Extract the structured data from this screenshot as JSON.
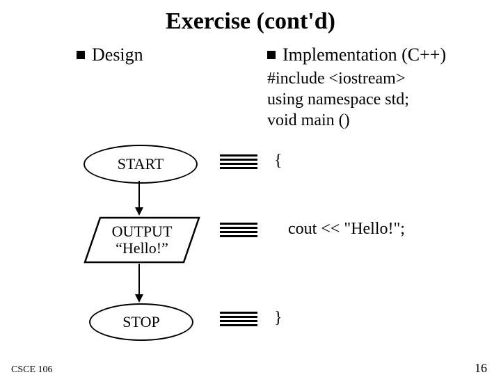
{
  "title": "Exercise (cont'd)",
  "left": {
    "heading": "Design",
    "flow": {
      "start": "START",
      "output_line1": "OUTPUT",
      "output_line2": "“Hello!”",
      "stop": "STOP"
    }
  },
  "right": {
    "heading": "Implementation (C++)",
    "preamble_l1": "#include <iostream>",
    "preamble_l2": "using namespace std;",
    "preamble_l3": "void main ()",
    "brace_open": "{",
    "cout_line": "cout << \"Hello!\";",
    "brace_close": "}"
  },
  "footer": {
    "left": "CSCE 106",
    "right": "16"
  }
}
